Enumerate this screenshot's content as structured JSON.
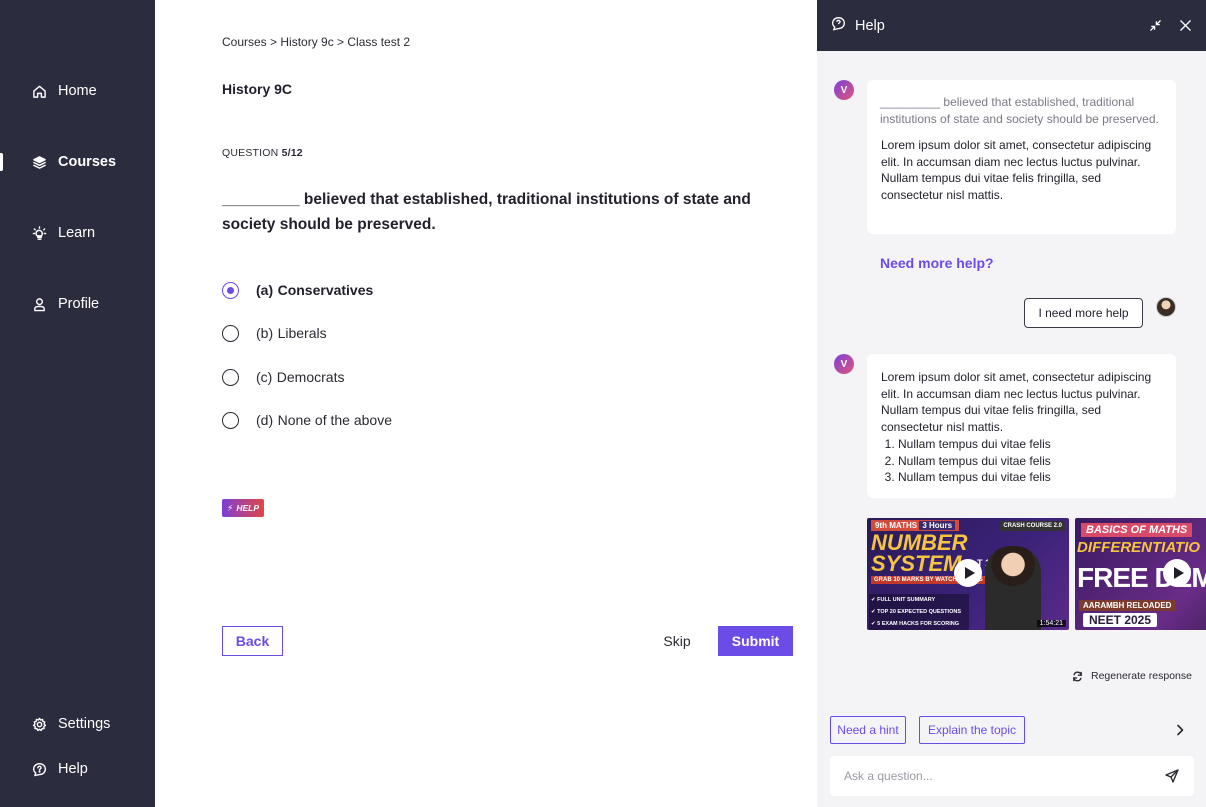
{
  "sidebar": {
    "items": [
      {
        "label": "Home",
        "icon": "home-icon"
      },
      {
        "label": "Courses",
        "icon": "layers-icon",
        "active": true
      },
      {
        "label": "Learn",
        "icon": "lightbulb-icon"
      },
      {
        "label": "Profile",
        "icon": "user-icon"
      }
    ],
    "bottom": [
      {
        "label": "Settings",
        "icon": "gear-icon"
      },
      {
        "label": "Help",
        "icon": "help-chat-icon"
      }
    ]
  },
  "main": {
    "breadcrumb": "Courses > History 9c > Class test 2",
    "course_title": "History 9C",
    "question_prefix": "QUESTION",
    "question_number": "5/12",
    "question_text": "_________ believed that established, traditional institutions of state and society should be preserved.",
    "options": [
      {
        "key": "(a)",
        "label": "Conservatives",
        "selected": true
      },
      {
        "key": "(b)",
        "label": "Liberals",
        "selected": false
      },
      {
        "key": "(c)",
        "label": "Democrats",
        "selected": false
      },
      {
        "key": "(d)",
        "label": "None of the above",
        "selected": false
      }
    ],
    "help_badge": "HELP",
    "back_label": "Back",
    "skip_label": "Skip",
    "submit_label": "Submit"
  },
  "accent_color": "#6c4ce6",
  "sidebar_color": "#2b2c3e",
  "panel": {
    "title": "Help",
    "bot_initial": "V",
    "message1": {
      "quote": "_________ believed that established, traditional institutions of state and society should be preserved.",
      "body": "Lorem ipsum dolor sit amet, consectetur adipiscing elit. In accumsan diam nec lectus luctus pulvinar. Nullam tempus dui vitae felis fringilla, sed consectetur nisl mattis."
    },
    "need_more_help": "Need more help?",
    "user_message": "I need more help",
    "message2": {
      "body": "Lorem ipsum dolor sit amet, consectetur adipiscing elit. In accumsan diam nec lectus luctus pulvinar. Nullam tempus dui vitae felis fringilla, sed consectetur nisl mattis.",
      "list": [
        "Nullam tempus dui vitae felis",
        "Nullam tempus dui vitae felis",
        "Nullam tempus dui vitae felis"
      ]
    },
    "videos": [
      {
        "tag_left": "9th MATHS",
        "tag_right": "3 Hours",
        "badge": "CRASH COURSE 2.0",
        "title": "NUMBER SYSTEM",
        "title_suffix": "T 1",
        "subtitle": "GRAB 10 MARKS BY WATCHING THIS VIDEO",
        "bullets": [
          "FULL UNIT SUMMARY",
          "TOP 20 EXPECTED QUESTIONS",
          "5 EXAM HACKS FOR SCORING 95%+"
        ],
        "duration": "1:54:21"
      },
      {
        "top": "BASICS OF MATHS",
        "title": "DIFFERENTIATIO",
        "big": "FREE DEMO",
        "subtitle": "AARAMBH RELOADED",
        "badge": "NEET 2025"
      }
    ],
    "regenerate": "Regenerate response",
    "chips": [
      "Need a hint",
      "Explain the topic"
    ],
    "ask_placeholder": "Ask a question..."
  }
}
